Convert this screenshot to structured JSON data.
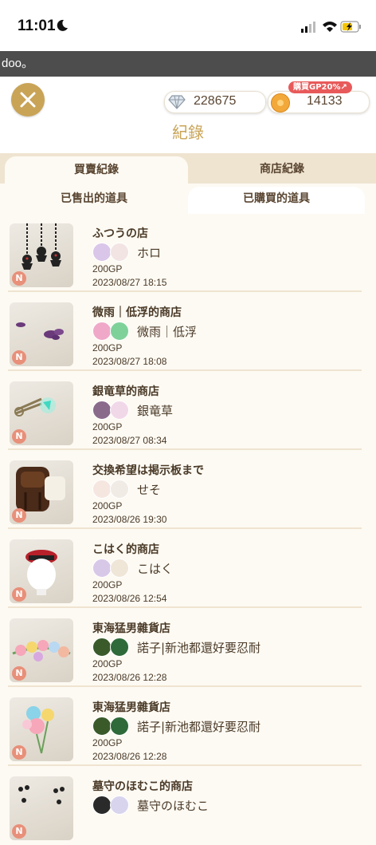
{
  "status_bar": {
    "time": "11:01"
  },
  "marquee": {
    "text": "doo。"
  },
  "currency": {
    "gems": "228675",
    "coins": "14133",
    "gp_badge": "購買GP20%↗"
  },
  "page": {
    "title": "紀錄"
  },
  "tabs_top": [
    {
      "label": "買賣紀錄",
      "active": true
    },
    {
      "label": "商店紀錄",
      "active": false
    }
  ],
  "tabs_sub": [
    {
      "label": "已售出的道具",
      "active": false
    },
    {
      "label": "已購買的道具",
      "active": true
    }
  ],
  "colors": {
    "accent": "#c9a457",
    "rank_badge": "#e8907a",
    "gp_badge": "#e85a5a"
  },
  "purchases": [
    {
      "shop": "ふつうの店",
      "owner": "ホロ",
      "price": "200GP",
      "date": "2023/08/27 18:15",
      "rank": "N",
      "item_icon": "hanging-charms"
    },
    {
      "shop": "微雨｜低浮的商店",
      "owner": "微雨｜低浮",
      "price": "200GP",
      "date": "2023/08/27 18:08",
      "rank": "N",
      "item_icon": "purple-splash"
    },
    {
      "shop": "銀竜草的商店",
      "owner": "銀竜草",
      "price": "200GP",
      "date": "2023/08/27 08:34",
      "rank": "N",
      "item_icon": "glowing-tweezers"
    },
    {
      "shop": "交換希望は掲示板まで",
      "owner": "せそ",
      "price": "200GP",
      "date": "2023/08/26 19:30",
      "rank": "N",
      "item_icon": "brown-backpack"
    },
    {
      "shop": "こはく的商店",
      "owner": "こはく",
      "price": "200GP",
      "date": "2023/08/26 12:54",
      "rank": "N",
      "item_icon": "red-hat"
    },
    {
      "shop": "東海猛男雜貨店",
      "owner": "諾子|新池都還好要忍耐",
      "price": "200GP",
      "date": "2023/08/26 12:28",
      "rank": "N",
      "item_icon": "flower-garland"
    },
    {
      "shop": "東海猛男雜貨店",
      "owner": "諾子|新池都還好要忍耐",
      "price": "200GP",
      "date": "2023/08/26 12:28",
      "rank": "N",
      "item_icon": "balloon-bouquet"
    },
    {
      "shop": "墓守のほむこ的商店",
      "owner": "墓守のほむこ",
      "price": "",
      "date": "",
      "rank": "N",
      "item_icon": "black-dots"
    }
  ]
}
